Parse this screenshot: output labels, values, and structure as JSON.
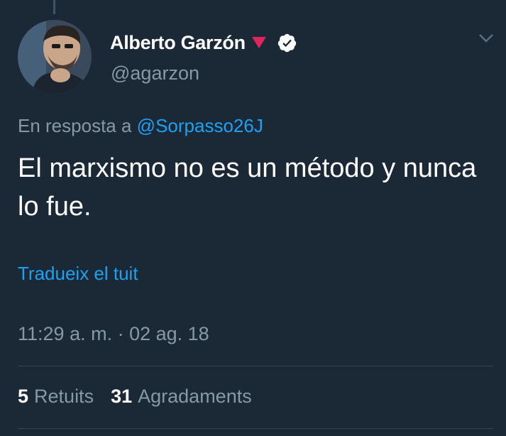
{
  "colors": {
    "background": "#1b2836",
    "text_primary": "#ffffff",
    "text_secondary": "#8899a6",
    "link": "#1da1f2",
    "rose": "#e0245e",
    "divider": "#38444d"
  },
  "tweet": {
    "author": {
      "display_name": "Alberto Garzón",
      "handle": "@agarzon",
      "avatar_icon": "user-avatar-photo",
      "emoji_icon": "down-triangle-rose-icon",
      "verified_icon": "verified-badge-icon"
    },
    "menu_icon": "chevron-down-icon",
    "reply_prefix": "En resposta a",
    "reply_mention": "@Sorpasso26J",
    "text": "El marxismo no es un método y nunca lo fue.",
    "translate_label": "Tradueix el tuit",
    "timestamp": "11:29 a. m. · 02 ag. 18",
    "stats": {
      "retweets_count": "5",
      "retweets_label": "Retuits",
      "likes_count": "31",
      "likes_label": "Agradaments"
    }
  }
}
